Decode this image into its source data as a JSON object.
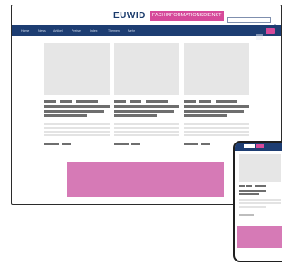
{
  "site": {
    "logo_text": "EUWID",
    "logo_tagline": "FACHINFORMATIONSDIENST",
    "accent_color": "#1d3d72",
    "brand_color": "#d64a9a"
  },
  "nav": {
    "items": [
      "Home",
      "News",
      "Artikel",
      "Preise",
      "Index",
      "Themen",
      "Mehr"
    ]
  },
  "search": {
    "placeholder": ""
  },
  "ad": {
    "color": "#d67ab6"
  },
  "icons": [
    "search-icon",
    "menu-icon",
    "user-icon"
  ]
}
